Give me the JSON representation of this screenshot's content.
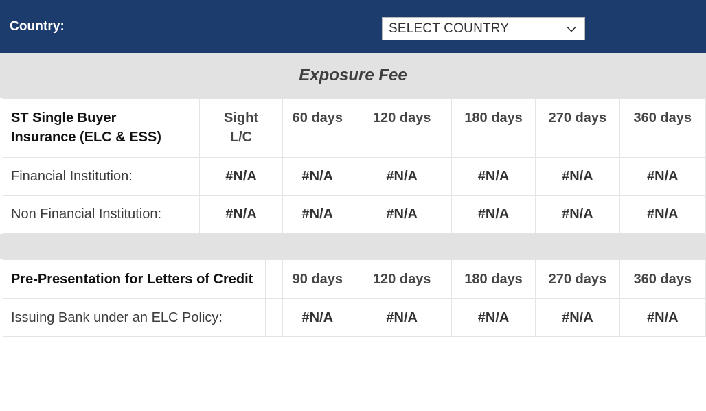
{
  "header": {
    "label": "Country:",
    "select": {
      "name": "country-select",
      "value": "SELECT COUNTRY",
      "placeholder": "SELECT COUNTRY",
      "chevron_icon": "chevron-down-icon"
    },
    "background_color": "#1d3c6e",
    "text_color": "#ffffff"
  },
  "bands": {
    "exposure_fee_title": "Exposure Fee",
    "background_color": "#e2e2e2"
  },
  "table_exposure": {
    "columns": [
      "ST Single Buyer Insurance (ELC & ESS)",
      "Sight L/C",
      "60 days",
      "120 days",
      "180 days",
      "270 days",
      "360 days"
    ],
    "header_main": "ST Single Buyer Insurance (ELC & ESS)",
    "header_main_line1": "ST Single Buyer",
    "header_main_line2": "Insurance (ELC & ESS)",
    "header_sight_line1": "Sight",
    "header_sight_line2": "L/C",
    "rows": [
      {
        "label": "Financial Institution:",
        "values": [
          "#N/A",
          "#N/A",
          "#N/A",
          "#N/A",
          "#N/A",
          "#N/A"
        ]
      },
      {
        "label": "Non Financial Institution:",
        "values": [
          "#N/A",
          "#N/A",
          "#N/A",
          "#N/A",
          "#N/A",
          "#N/A"
        ]
      }
    ]
  },
  "table_prepresentation": {
    "columns": [
      "Pre-Presentation for Letters of Credit",
      "",
      "90 days",
      "120 days",
      "180 days",
      "270 days",
      "360 days"
    ],
    "header_main": "Pre-Presentation for Letters of Credit",
    "header_blank": "",
    "rows": [
      {
        "label": "Issuing Bank under an ELC Policy:",
        "blank": "",
        "values": [
          "#N/A",
          "#N/A",
          "#N/A",
          "#N/A",
          "#N/A"
        ]
      }
    ]
  }
}
